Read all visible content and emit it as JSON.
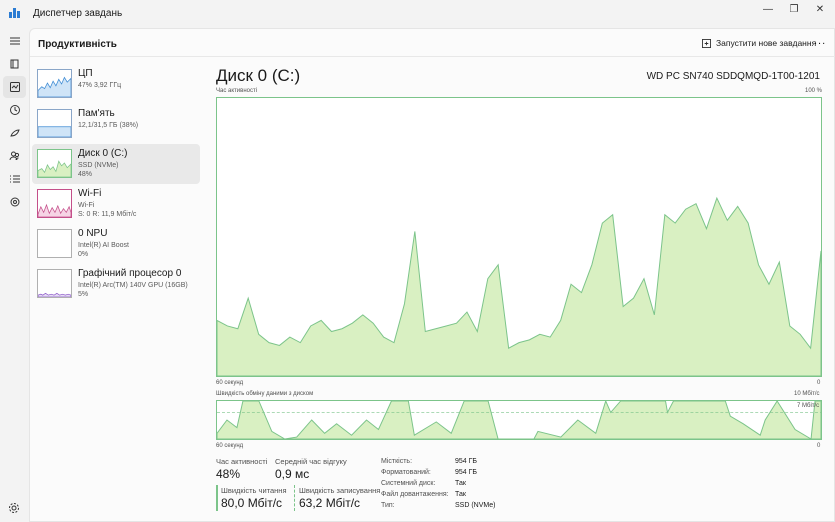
{
  "window": {
    "title": "Диспетчер завдань"
  },
  "header": {
    "section_title": "Продуктивність",
    "run_task_label": "Запустити нове завдання",
    "more": "..."
  },
  "nav": {
    "icons": [
      "hamburger-icon",
      "processes-icon",
      "performance-icon",
      "app-history-icon",
      "startup-icon",
      "users-icon",
      "details-icon",
      "services-icon",
      "settings-icon"
    ]
  },
  "devices": [
    {
      "name": "ЦП",
      "line1": "47% 3,92 ГГц",
      "line2": ""
    },
    {
      "name": "Пам'ять",
      "line1": "12,1/31,5 ГБ (38%)",
      "line2": ""
    },
    {
      "name": "Диск 0 (C:)",
      "line1": "SSD (NVMe)",
      "line2": "48%"
    },
    {
      "name": "Wi-Fi",
      "line1": "Wi-Fi",
      "line2": "S: 0 R: 11,9 Мбіт/с"
    },
    {
      "name": "0 NPU",
      "line1": "Intel(R) AI Boost",
      "line2": "0%"
    },
    {
      "name": "Графічний процесор 0",
      "line1": "Intel(R) Arc(TM) 140V GPU (16GB)",
      "line2": "5%"
    }
  ],
  "detail": {
    "title": "Диск 0 (C:)",
    "model": "WD PC SN740 SDDQMQD-1T00-1201",
    "graph1_label": "Час активності",
    "graph1_max": "100 %",
    "graph1_xleft": "60 секунд",
    "graph1_xright": "0",
    "graph2_label": "Швидкість обміну даними з диском",
    "graph2_max": "10 Мбіт/с",
    "graph2_ref": "7 Мбіт/с",
    "graph2_xleft": "60 секунд",
    "graph2_xright": "0"
  },
  "stats": {
    "activity_label": "Час активності",
    "activity_value": "48%",
    "response_label": "Середній час відгуку",
    "response_value": "0,9 мс",
    "read_label": "Швидкість читання",
    "read_value": "80,0 Мбіт/с",
    "write_label": "Швидкість записування",
    "write_value": "63,2 Мбіт/с"
  },
  "properties": [
    {
      "key": "Місткість:",
      "value": "954 ГБ"
    },
    {
      "key": "Форматований:",
      "value": "954 ГБ"
    },
    {
      "key": "Системний диск:",
      "value": "Так"
    },
    {
      "key": "Файл довантаження:",
      "value": "Так"
    },
    {
      "key": "Тип:",
      "value": "SSD (NVMe)"
    }
  ],
  "colors": {
    "disk_green": "#7cc48a",
    "disk_fill": "#d9f0c2",
    "cpu_blue": "#3d8bd4",
    "wifi_pink": "#c44f8a",
    "gpu_purple": "#8c5ac8"
  },
  "activity_series": [
    20,
    18,
    17,
    28,
    15,
    12,
    11,
    14,
    12,
    18,
    20,
    16,
    17,
    19,
    22,
    19,
    14,
    12,
    26,
    52,
    16,
    17,
    18,
    19,
    23,
    16,
    35,
    40,
    10,
    12,
    13,
    15,
    14,
    20,
    33,
    30,
    40,
    55,
    58,
    25,
    28,
    35,
    22,
    58,
    55,
    60,
    62,
    53,
    64,
    56,
    61,
    55,
    40,
    33,
    41,
    18,
    15,
    10,
    45
  ]
}
